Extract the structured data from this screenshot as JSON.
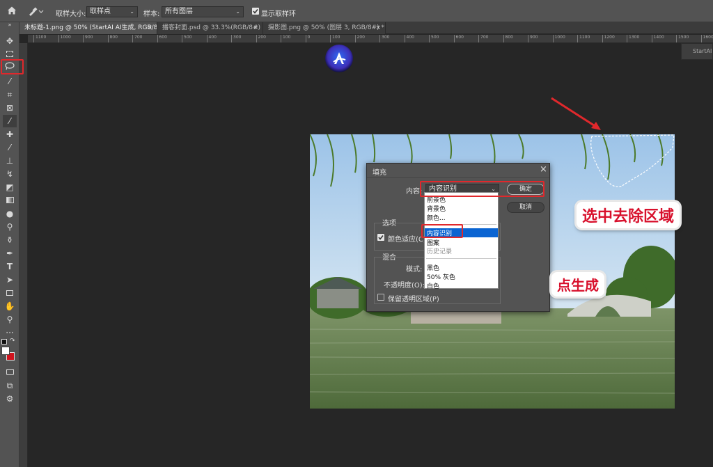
{
  "options_bar": {
    "sample_size_label": "取样大小:",
    "sample_size_value": "取样点",
    "sample_label": "样本:",
    "sample_value": "所有图层",
    "show_ring_label": "显示取样环",
    "show_ring_checked": true
  },
  "tabs": [
    {
      "label": "未标题-1.png @ 50% (StartAI AI生成, RGB/8) *",
      "active": true
    },
    {
      "label": "播客封面.psd @ 33.3%(RGB/8#) *",
      "active": false
    },
    {
      "label": "摄影图.png @ 50% (图层 3, RGB/8#) *",
      "active": false
    }
  ],
  "ruler_ticks": [
    "1100",
    "1000",
    "900",
    "800",
    "700",
    "600",
    "500",
    "400",
    "300",
    "200",
    "100",
    "0",
    "100",
    "200",
    "300",
    "400",
    "500",
    "600",
    "700",
    "800",
    "900",
    "1000",
    "1100",
    "1200",
    "1300",
    "1400",
    "1500",
    "1600",
    "1700"
  ],
  "side_panel_label": "StartAI",
  "fill_dialog": {
    "title": "填充",
    "content_label": "内容:",
    "content_value": "内容识别",
    "ok_label": "确定",
    "cancel_label": "取消",
    "options_section": "选项",
    "color_adapt_label": "颜色适应(C)",
    "color_adapt_checked": true,
    "blend_section": "混合",
    "mode_label": "模式:",
    "opacity_label": "不透明度(O):",
    "preserve_label": "保留透明区域(P)",
    "preserve_checked": false
  },
  "content_menu": {
    "group1": [
      "前景色",
      "背景色",
      "颜色..."
    ],
    "group2": [
      "内容识别",
      "图案",
      "历史记录"
    ],
    "group3": [
      "黑色",
      "50% 灰色",
      "白色"
    ],
    "selected": "内容识别"
  },
  "annotations": {
    "select_area": "选中去除区域",
    "click_generate": "点生成"
  },
  "colors": {
    "panel": "#535353",
    "canvas": "#262626",
    "highlight_blue": "#0a64d2",
    "annotation_red": "#e0282c"
  }
}
